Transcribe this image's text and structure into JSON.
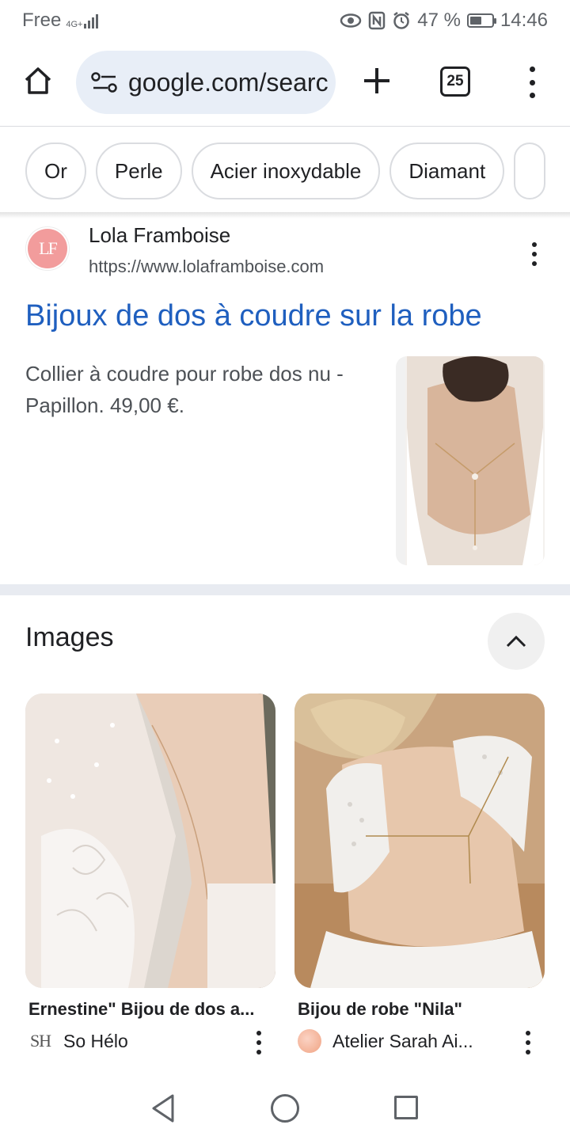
{
  "status_bar": {
    "carrier": "Free",
    "network": "4G+",
    "battery_pct": "47 %",
    "time": "14:46"
  },
  "browser": {
    "url": "google.com/searc",
    "tab_count": "25"
  },
  "chips": [
    "Or",
    "Perle",
    "Acier inoxydable",
    "Diamant"
  ],
  "result": {
    "site_name": "Lola Framboise",
    "site_url": "https://www.lolaframboise.com",
    "favicon_text": "LF",
    "title": "Bijoux de dos à coudre sur la robe",
    "snippet": "Collier à coudre pour robe dos nu - Papillon. 49,00 €."
  },
  "images_section": {
    "title": "Images",
    "items": [
      {
        "caption": "Ernestine\" Bijou de dos a...",
        "source": "So Hélo",
        "logo_text": "SH"
      },
      {
        "caption": "Bijou de robe \"Nila\"",
        "source": "Atelier Sarah Ai..."
      }
    ]
  },
  "colors": {
    "link": "#1f5fbf",
    "omnibox": "#e8eef7",
    "favicon": "#f29c9c"
  }
}
